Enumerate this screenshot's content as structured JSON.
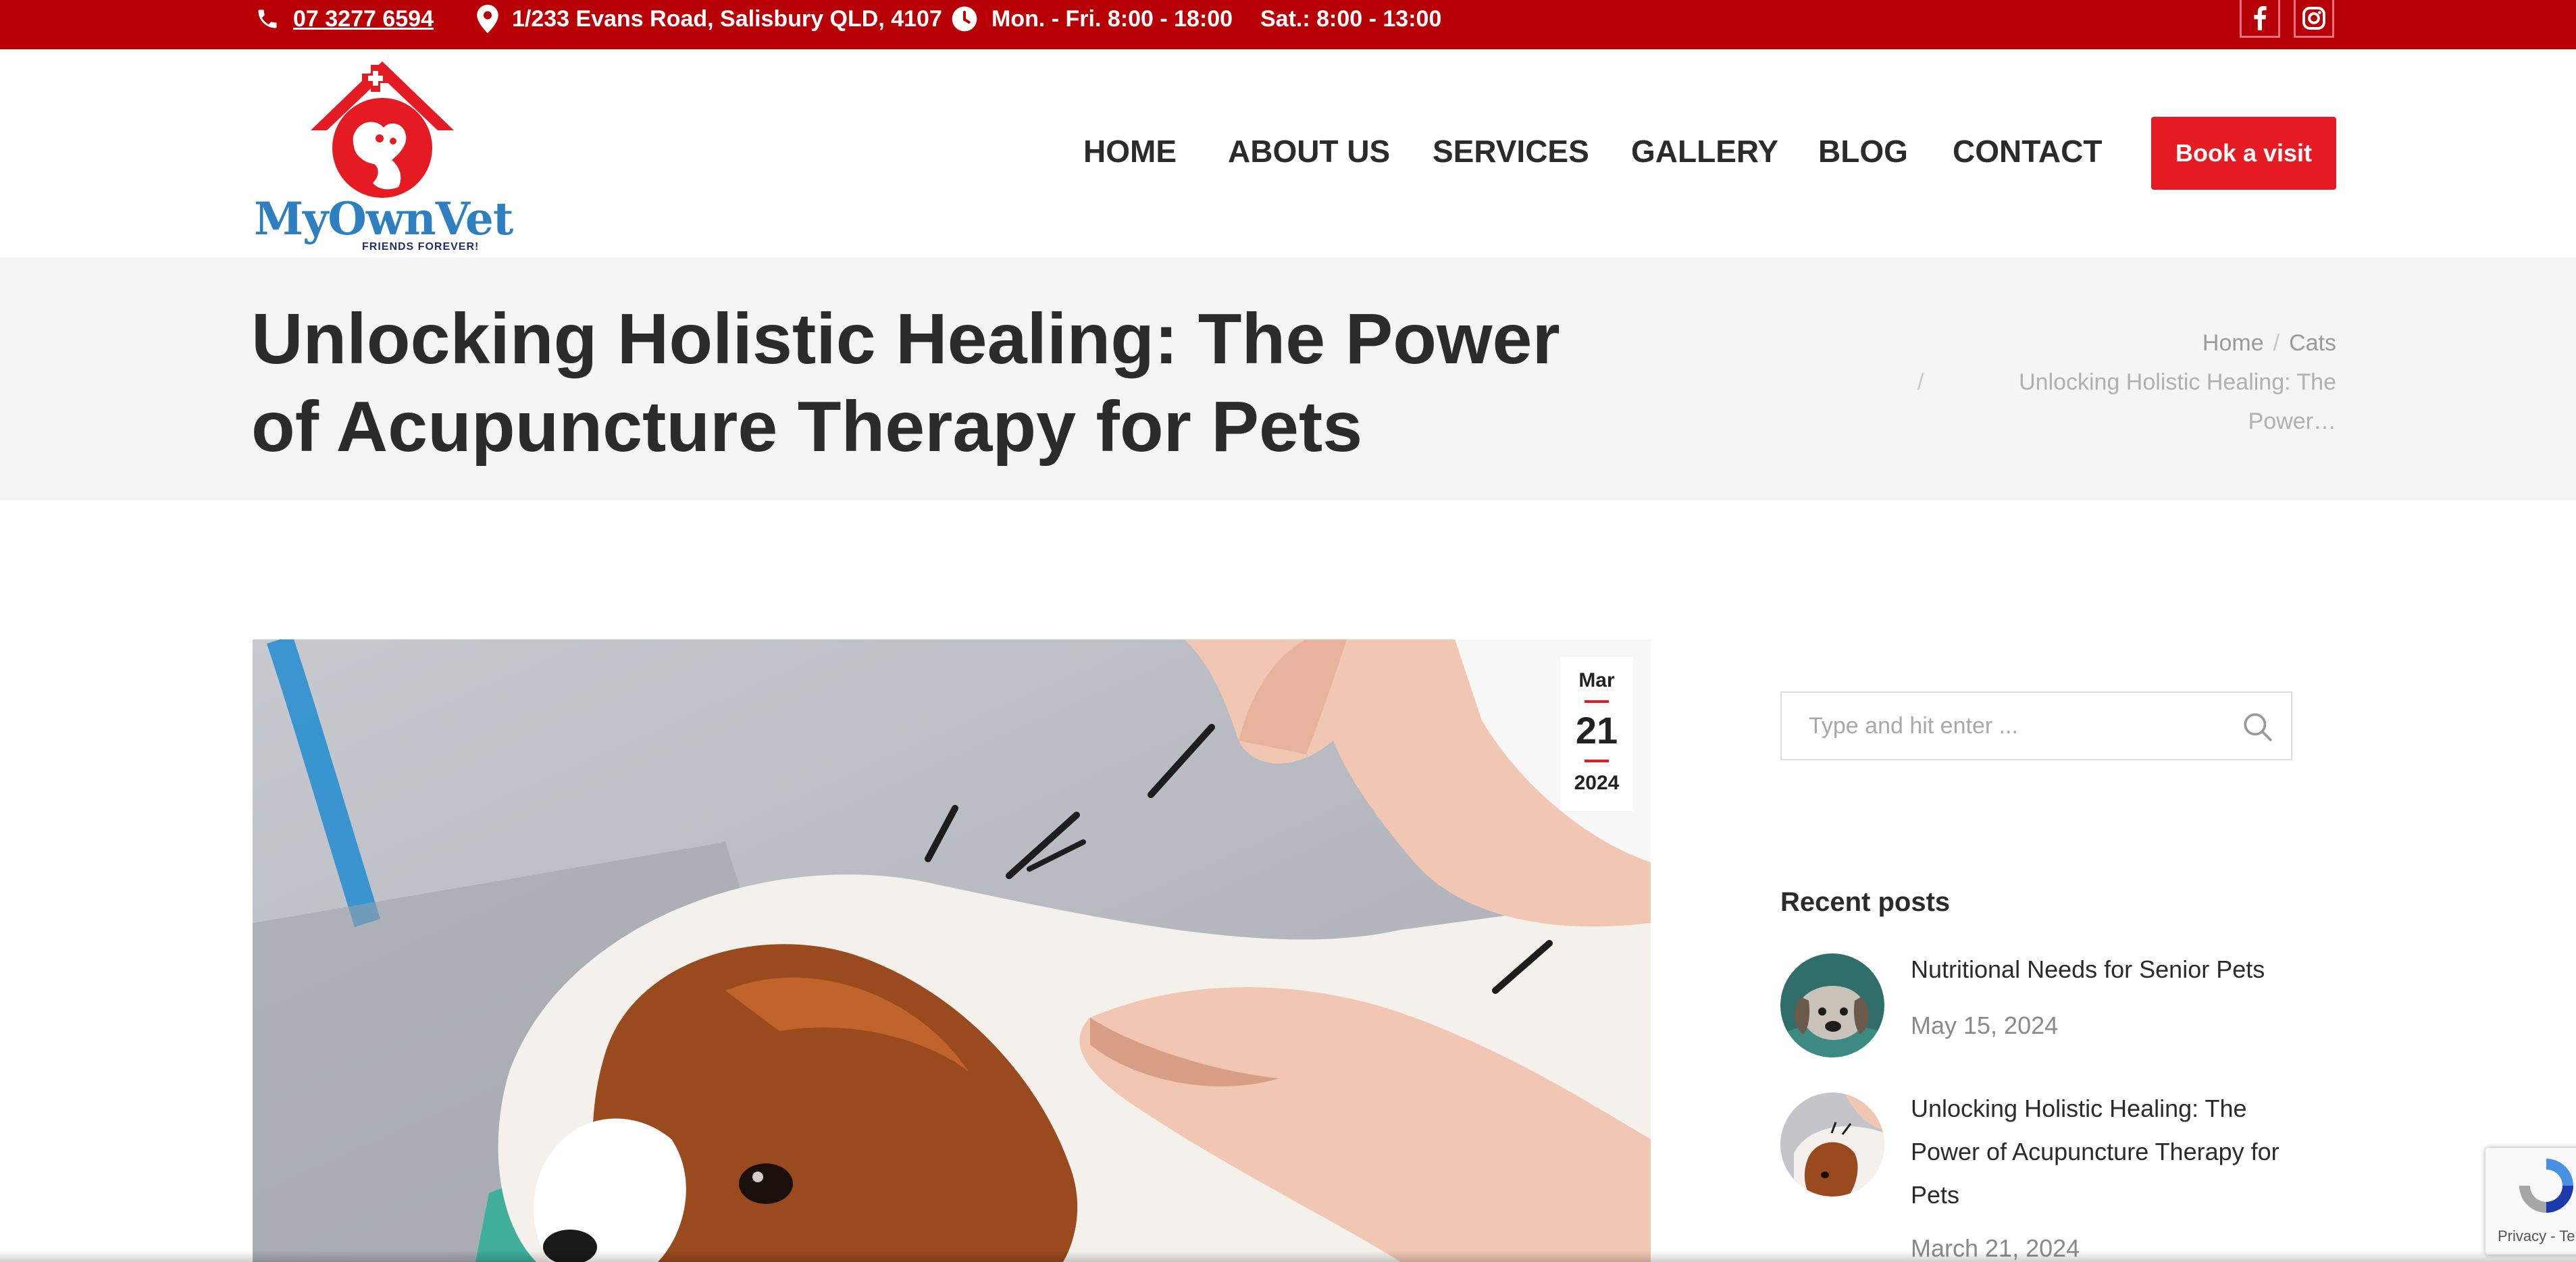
{
  "topbar": {
    "phone": "07 3277 6594",
    "address": "1/233 Evans Road, Salisbury QLD, 4107",
    "hours_weekday": "Mon. - Fri. 8:00 - 18:00",
    "hours_saturday": "Sat.: 8:00 - 13:00",
    "social": [
      "facebook-icon",
      "instagram-icon"
    ]
  },
  "logo": {
    "wordmark": "MyOwnVet",
    "tagline": "FRIENDS FOREVER!"
  },
  "nav": {
    "items": [
      {
        "label": "HOME"
      },
      {
        "label": "ABOUT US"
      },
      {
        "label": "SERVICES"
      },
      {
        "label": "GALLERY"
      },
      {
        "label": "BLOG"
      },
      {
        "label": "CONTACT"
      }
    ],
    "cta_label": "Book a visit"
  },
  "page": {
    "title": "Unlocking Holistic Healing: The Power of Acupuncture Therapy for Pets",
    "breadcrumb": {
      "home": "Home",
      "category": "Cats",
      "separator": "/",
      "current": "Unlocking Holistic Healing: The Power…"
    }
  },
  "post": {
    "date_month": "Mar",
    "date_day": "21",
    "date_year": "2024"
  },
  "sidebar": {
    "search_placeholder": "Type and hit enter ...",
    "recent_heading": "Recent posts",
    "recent_posts": [
      {
        "title": "Nutritional Needs for Senior Pets",
        "date": "May 15, 2024"
      },
      {
        "title": "Unlocking Holistic Healing: The Power of Acupuncture Therapy for Pets",
        "date": "March 21, 2024"
      }
    ]
  },
  "recaptcha": {
    "text": "Privacy - Ter"
  },
  "colors": {
    "topbar_red": "#b80007",
    "accent_red": "#e51b24",
    "logo_blue": "#2e7fbf"
  }
}
